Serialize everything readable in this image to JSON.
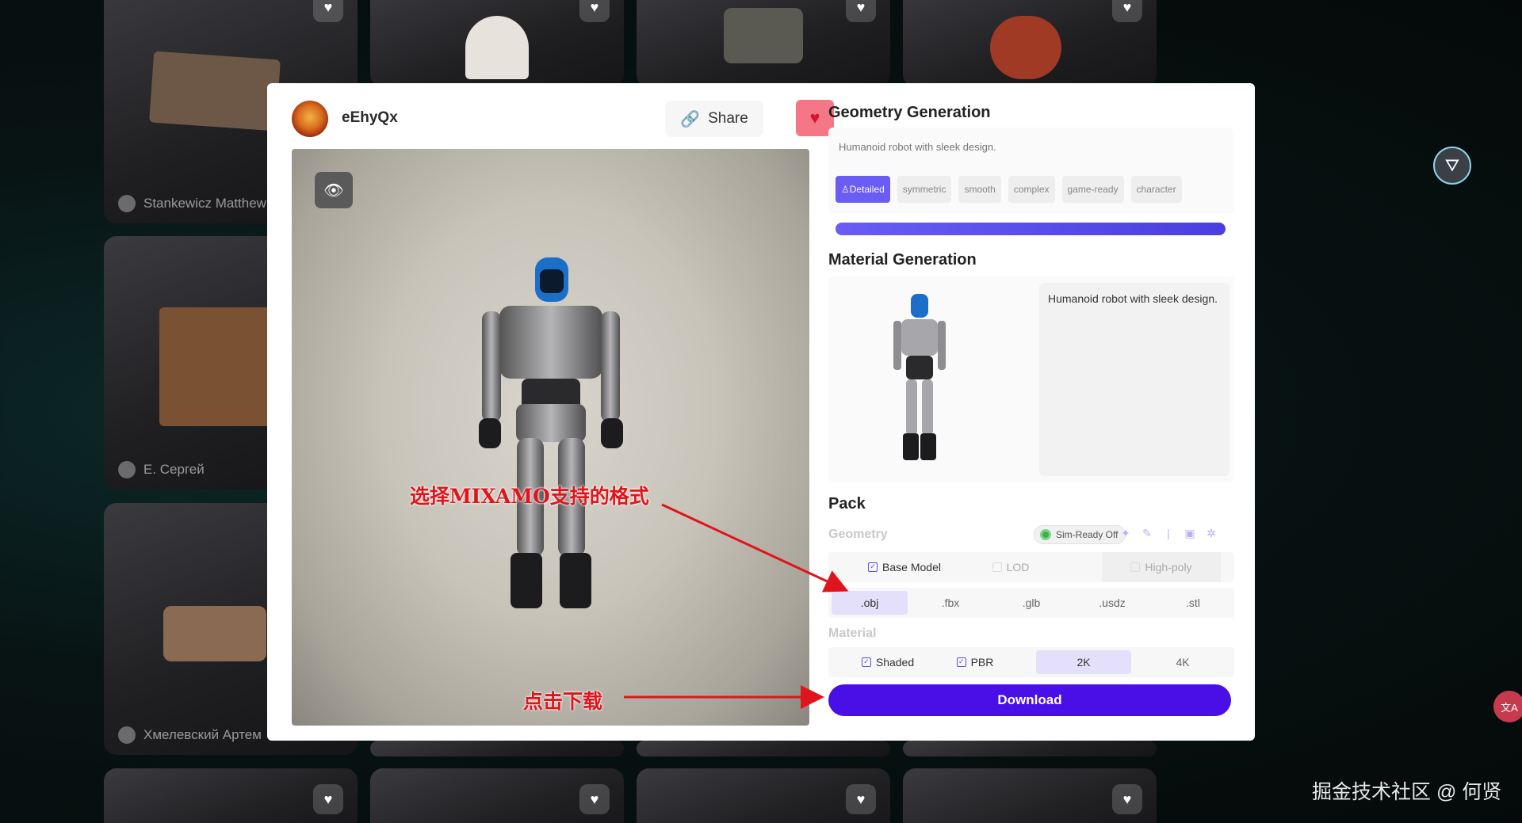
{
  "gallery": {
    "authors": [
      "Stankewicz Matthew",
      "E. Сергей",
      "Хмелевский Артем"
    ],
    "heart_icon": "heart-icon"
  },
  "modal": {
    "username": "eEhyQx",
    "share_label": "Share",
    "geometry": {
      "title": "Geometry Generation",
      "prompt": "Humanoid robot with sleek design.",
      "tags": [
        "Detailed",
        "symmetric",
        "smooth",
        "complex",
        "game-ready",
        "character"
      ],
      "active_tag": "Detailed"
    },
    "material": {
      "title": "Material Generation",
      "prompt": "Humanoid robot with sleek design."
    },
    "pack": {
      "title": "Pack",
      "geometry_label": "Geometry",
      "sim_ready": "Sim-Ready Off",
      "model_options": [
        "Base Model",
        "LOD",
        "High-poly"
      ],
      "formats": [
        ".obj",
        ".fbx",
        ".glb",
        ".usdz",
        ".stl"
      ],
      "selected_format": ".obj",
      "material_label": "Material",
      "material_options": [
        "Shaded",
        "PBR"
      ],
      "resolutions": [
        "2K",
        "4K"
      ],
      "selected_resolution": "2K",
      "download_label": "Download"
    }
  },
  "annotations": {
    "format_hint": "选择MIXAMO支持的格式",
    "download_hint": "点击下载"
  },
  "watermark": "掘金技术社区 @ 何贤",
  "colors": {
    "accent": "#4a0fe6",
    "tag_active": "#6a5cf5",
    "favorite": "#f57787",
    "annotation": "#e0151b"
  }
}
